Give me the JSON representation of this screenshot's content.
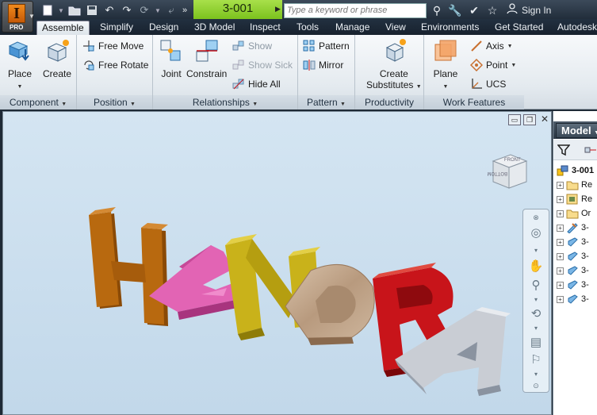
{
  "app": {
    "badge": "PRO",
    "document_title": "3-001",
    "search_placeholder": "Type a keyword or phrase",
    "sign_in": "Sign In"
  },
  "tabs": [
    "Assemble",
    "Simplify",
    "Design",
    "3D Model",
    "Inspect",
    "Tools",
    "Manage",
    "View",
    "Environments",
    "Get Started",
    "Autodesk"
  ],
  "active_tab": "Assemble",
  "ribbon": {
    "component": {
      "label": "Component",
      "place": "Place",
      "create": "Create"
    },
    "position": {
      "label": "Position",
      "free_move": "Free Move",
      "free_rotate": "Free Rotate"
    },
    "relationships": {
      "label": "Relationships",
      "joint": "Joint",
      "constrain": "Constrain",
      "show": "Show",
      "show_sick": "Show Sick",
      "hide_all": "Hide All"
    },
    "pattern": {
      "label": "Pattern",
      "pattern": "Pattern",
      "mirror": "Mirror"
    },
    "productivity": {
      "label": "Productivity",
      "create_substitutes_1": "Create",
      "create_substitutes_2": "Substitutes"
    },
    "work_features": {
      "label": "Work Features",
      "plane": "Plane",
      "axis": "Axis",
      "point": "Point",
      "ucs": "UCS"
    }
  },
  "viewport": {
    "model_letters": [
      "H",
      "E",
      "N",
      "D",
      "R",
      "A"
    ],
    "letter_colors": [
      "#b8690f",
      "#e264b4",
      "#c9b21a",
      "#c4a88c",
      "#c8141a",
      "#c9cdd4"
    ],
    "viewcube_labels": {
      "front": "FRONT",
      "bottom": "BOTTOM"
    }
  },
  "browser": {
    "tab": "Model",
    "root": "3-001",
    "items": [
      "Re",
      "Re",
      "Or",
      "3-",
      "3-",
      "3-",
      "3-",
      "3-",
      "3-"
    ]
  }
}
